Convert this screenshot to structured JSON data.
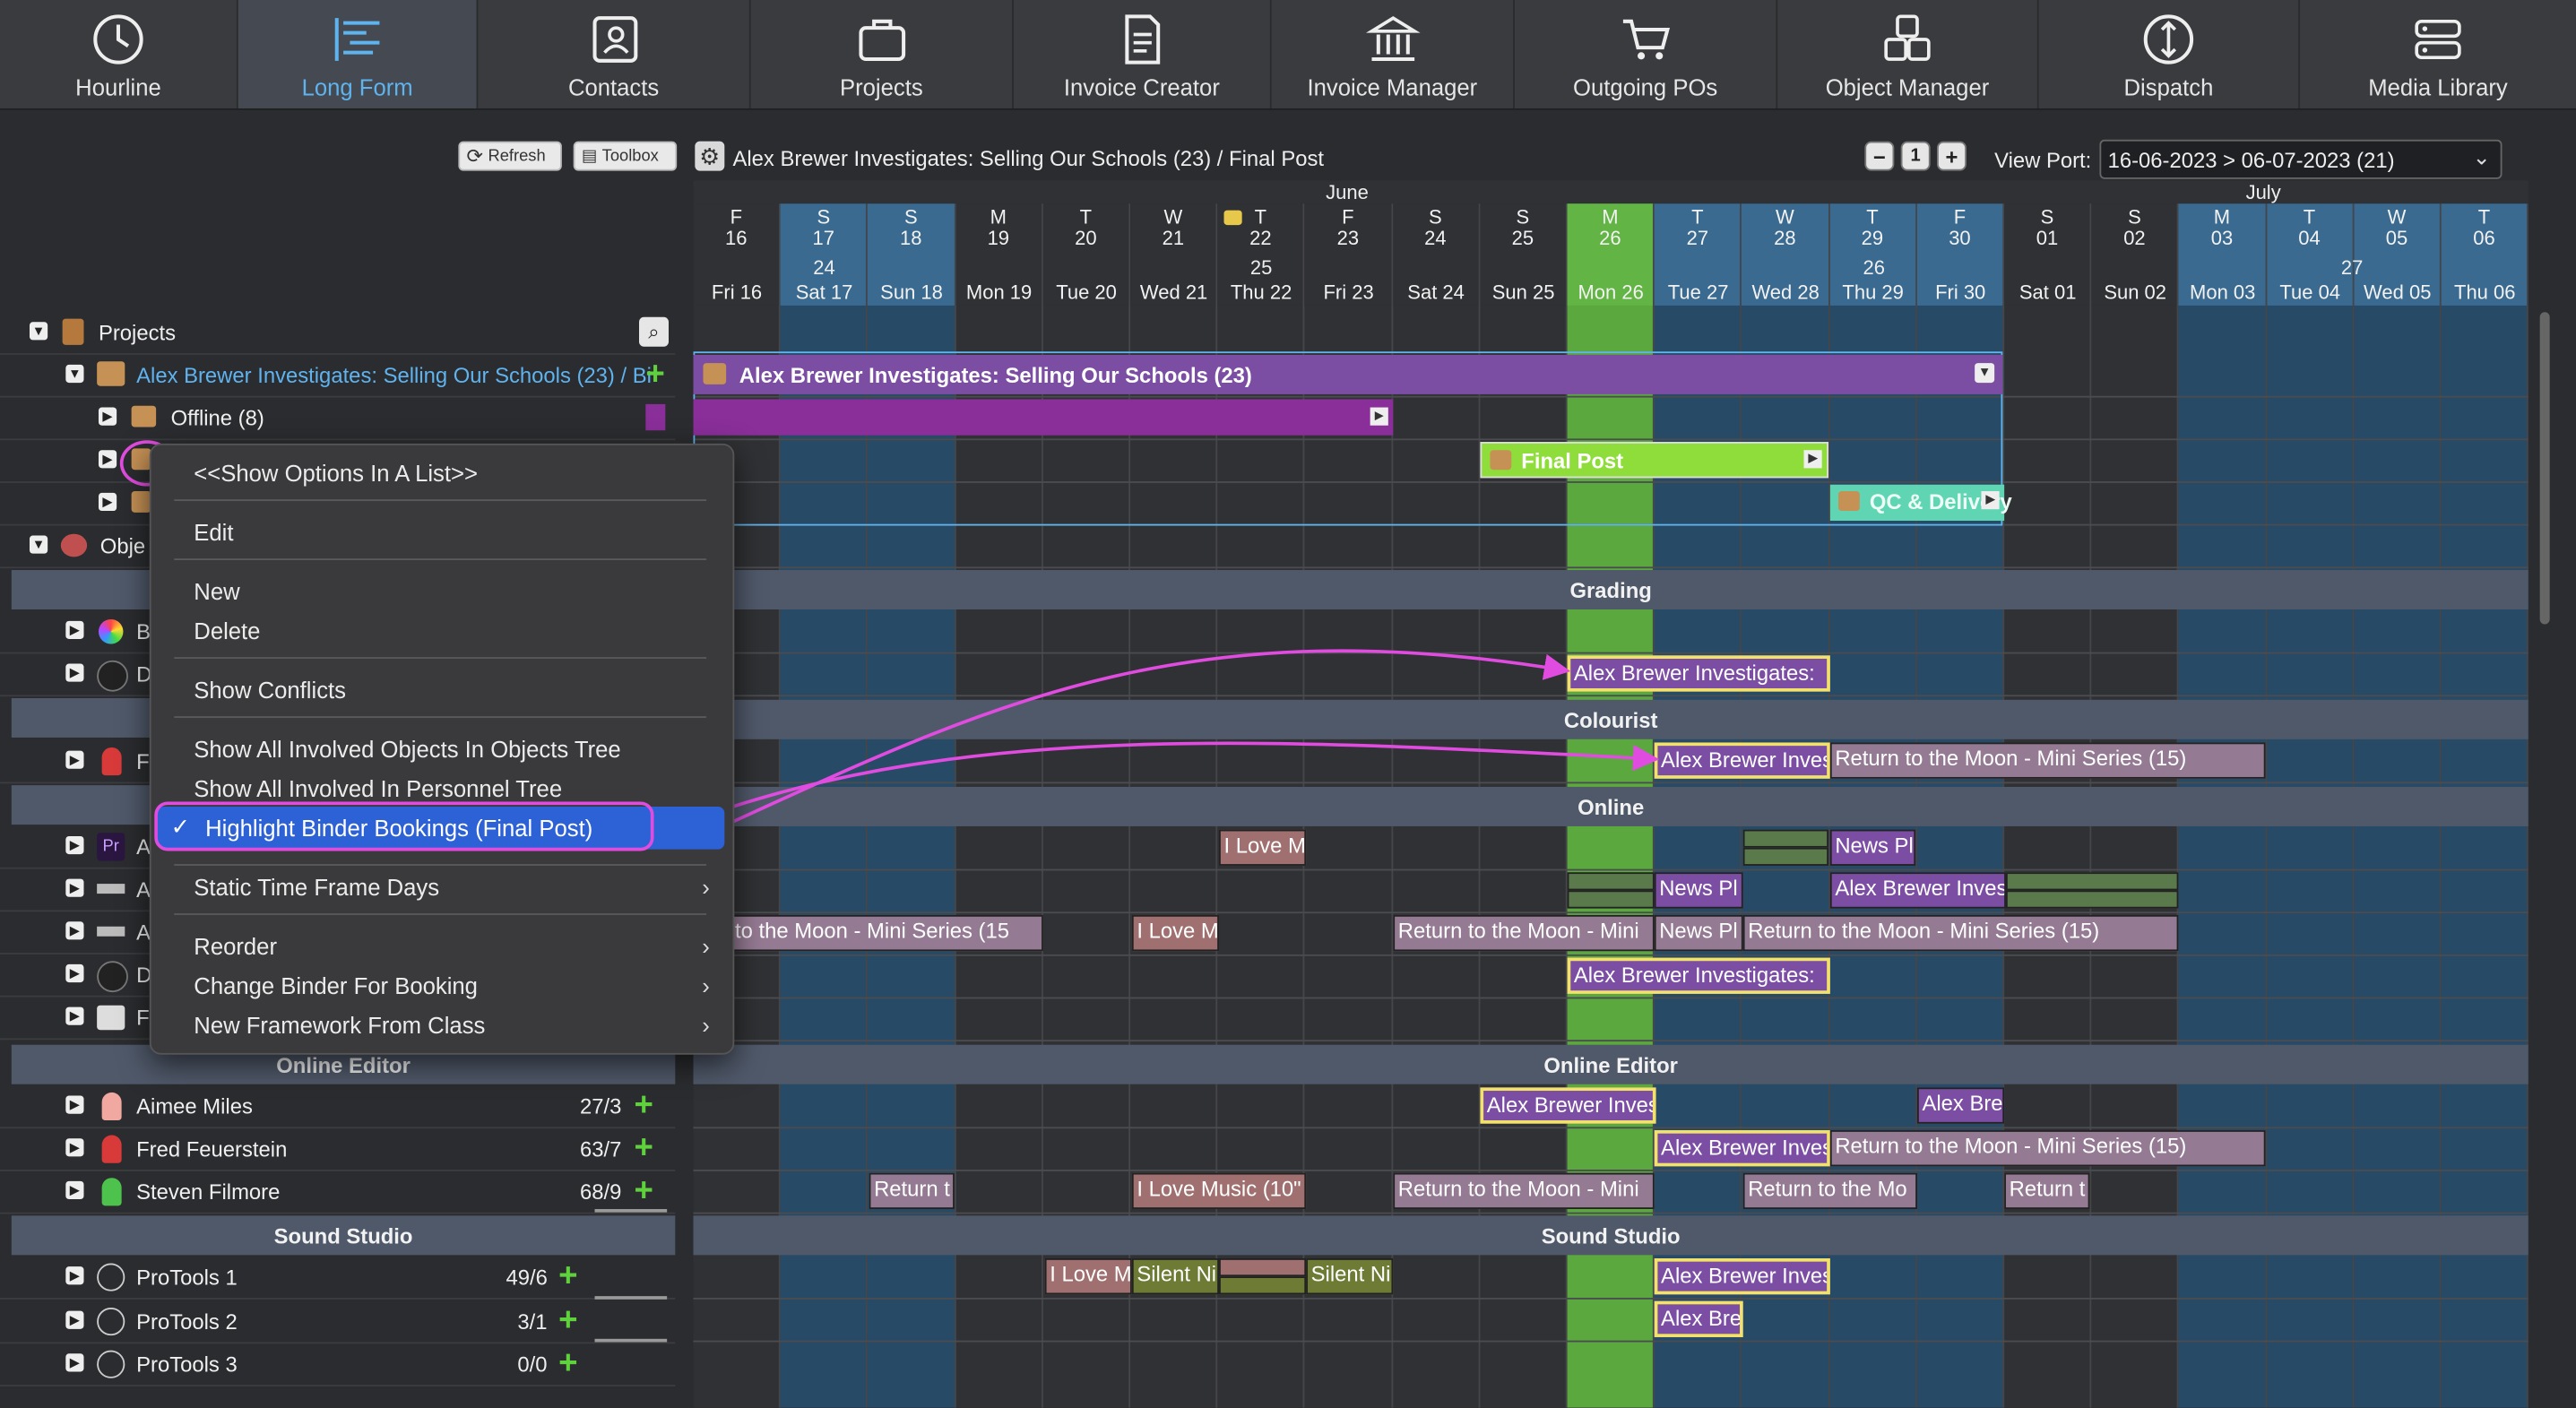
{
  "nav": [
    {
      "label": "Hourline",
      "icon": "clock-icon"
    },
    {
      "label": "Long Form",
      "icon": "long-form-icon",
      "active": true
    },
    {
      "label": "Contacts",
      "icon": "contacts-icon"
    },
    {
      "label": "Projects",
      "icon": "briefcase-icon"
    },
    {
      "label": "Invoice Creator",
      "icon": "document-icon"
    },
    {
      "label": "Invoice Manager",
      "icon": "bank-icon"
    },
    {
      "label": "Outgoing POs",
      "icon": "cart-icon"
    },
    {
      "label": "Object Manager",
      "icon": "objects-icon"
    },
    {
      "label": "Dispatch",
      "icon": "dispatch-icon"
    },
    {
      "label": "Media Library",
      "icon": "server-icon"
    }
  ],
  "toolbar": {
    "refresh": "Refresh",
    "toolbox": "Toolbox"
  },
  "title": "Alex Brewer Investigates: Selling Our Schools (23) /  Final Post",
  "viewport": {
    "label": "View Port:",
    "value": "16-06-2023 > 06-07-2023 (21)"
  },
  "tree": {
    "projects": "Projects",
    "project": "Alex Brewer Investigates: Selling Our Schools (23) / Bi",
    "offline": "Offline (8)",
    "objects": "Obje",
    "online_editor": "Online Editor",
    "sound_studio": "Sound Studio",
    "editors": [
      {
        "name": "Aimee Miles",
        "count": "27/3"
      },
      {
        "name": "Fred Feuerstein",
        "count": "63/7"
      },
      {
        "name": "Steven Filmore",
        "count": "68/9"
      }
    ],
    "studios": [
      {
        "name": "ProTools 1",
        "count": "49/6"
      },
      {
        "name": "ProTools 2",
        "count": "3/1"
      },
      {
        "name": "ProTools 3",
        "count": "0/0"
      }
    ],
    "truncated": [
      "B",
      "D",
      "F",
      "A",
      "A",
      "A",
      "D",
      "F"
    ]
  },
  "menu": {
    "items": [
      "<<Show Options In A List>>",
      "Edit",
      "New",
      "Delete",
      "Show Conflicts",
      "Show All Involved Objects In Objects Tree",
      "Show All Involved In Personnel Tree",
      "Highlight Binder Bookings (Final Post)",
      "Static Time Frame Days",
      "Reorder",
      "Change Binder For Booking",
      "New Framework From Class"
    ],
    "check": "✓"
  },
  "timeline": {
    "months": [
      "June",
      "July"
    ],
    "days": [
      {
        "l": "F",
        "n": "16",
        "d": "Fri 16"
      },
      {
        "l": "S",
        "n": "17",
        "d": "Sat 17"
      },
      {
        "l": "S",
        "n": "18",
        "d": "Sun 18"
      },
      {
        "l": "M",
        "n": "19",
        "d": "Mon 19"
      },
      {
        "l": "T",
        "n": "20",
        "d": "Tue 20"
      },
      {
        "l": "W",
        "n": "21",
        "d": "Wed 21"
      },
      {
        "l": "T",
        "n": "22",
        "d": "Thu 22"
      },
      {
        "l": "F",
        "n": "23",
        "d": "Fri 23"
      },
      {
        "l": "S",
        "n": "24",
        "d": "Sat 24"
      },
      {
        "l": "S",
        "n": "25",
        "d": "Sun 25"
      },
      {
        "l": "M",
        "n": "26",
        "d": "Mon 26"
      },
      {
        "l": "T",
        "n": "27",
        "d": "Tue 27"
      },
      {
        "l": "W",
        "n": "28",
        "d": "Wed 28"
      },
      {
        "l": "T",
        "n": "29",
        "d": "Thu 29"
      },
      {
        "l": "F",
        "n": "30",
        "d": "Fri 30"
      },
      {
        "l": "S",
        "n": "01",
        "d": "Sat 01"
      },
      {
        "l": "S",
        "n": "02",
        "d": "Sun 02"
      },
      {
        "l": "M",
        "n": "03",
        "d": "Mon 03"
      },
      {
        "l": "T",
        "n": "04",
        "d": "Tue 04"
      },
      {
        "l": "W",
        "n": "05",
        "d": "Wed 05"
      },
      {
        "l": "T",
        "n": "06",
        "d": "Thu 06"
      }
    ],
    "weeks": [
      "24",
      "25",
      "26",
      "27"
    ],
    "project_bar": "Alex Brewer Investigates: Selling Our Schools (23)",
    "final_post": "Final Post",
    "qc": "QC & Delivery",
    "sections": {
      "grading": "Grading",
      "colourist": "Colourist",
      "online": "Online",
      "online_editor": "Online Editor",
      "sound_studio": "Sound Studio"
    },
    "bookings": {
      "abi": "Alex Brewer Investigates:",
      "abinv": "Alex Brewer Inves",
      "abre": "Alex Bre",
      "rtm15": "Return to the Moon - Mini Series (15)",
      "rtm15b": "urn to the Moon - Mini Series (15",
      "rtm": "Return to the Moon - Mini",
      "rtmo": "Return to the Mo",
      "rett": "Return t",
      "ilovem": "I Love M",
      "ilovemusic": "I Love Music (10\"",
      "newspl": "News Pl",
      "silent": "Silent Ni"
    }
  }
}
